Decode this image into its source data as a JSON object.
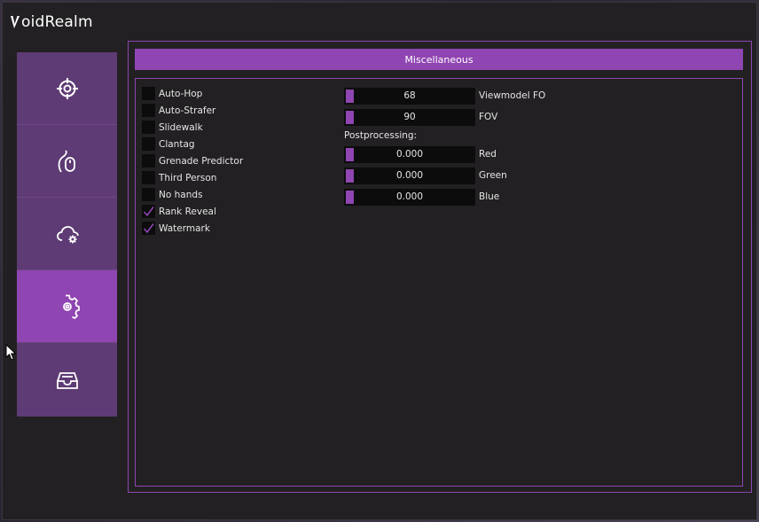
{
  "app": {
    "title": "oidRealm",
    "logo_icon": "v-logo-icon"
  },
  "sidebar": {
    "tabs": [
      {
        "icon": "crosshair-icon",
        "active": false
      },
      {
        "icon": "mouse-icon",
        "active": false
      },
      {
        "icon": "cloud-gear-icon",
        "active": false
      },
      {
        "icon": "gear-icon",
        "active": true
      },
      {
        "icon": "inbox-tray-icon",
        "active": false
      }
    ]
  },
  "panel": {
    "header": "Miscellaneous",
    "checkboxes": [
      {
        "label": "Auto-Hop",
        "checked": false
      },
      {
        "label": "Auto-Strafer",
        "checked": false
      },
      {
        "label": "Slidewalk",
        "checked": false
      },
      {
        "label": "Clantag",
        "checked": false
      },
      {
        "label": "Grenade Predictor",
        "checked": false
      },
      {
        "label": "Third Person",
        "checked": false
      },
      {
        "label": "No hands",
        "checked": false
      },
      {
        "label": "Rank Reveal",
        "checked": true
      },
      {
        "label": "Watermark",
        "checked": true
      }
    ],
    "sliders_top": [
      {
        "value": "68",
        "label": "Viewmodel FO"
      },
      {
        "value": "90",
        "label": "FOV"
      }
    ],
    "postprocessing_label": "Postprocessing:",
    "sliders_post": [
      {
        "value": "0.000",
        "label": "Red"
      },
      {
        "value": "0.000",
        "label": "Green"
      },
      {
        "value": "0.000",
        "label": "Blue"
      }
    ]
  },
  "colors": {
    "accent": "#8f45b2",
    "tab_bg": "#5e3b74",
    "window_bg": "#222022",
    "control_bg": "#0c0c0c"
  }
}
